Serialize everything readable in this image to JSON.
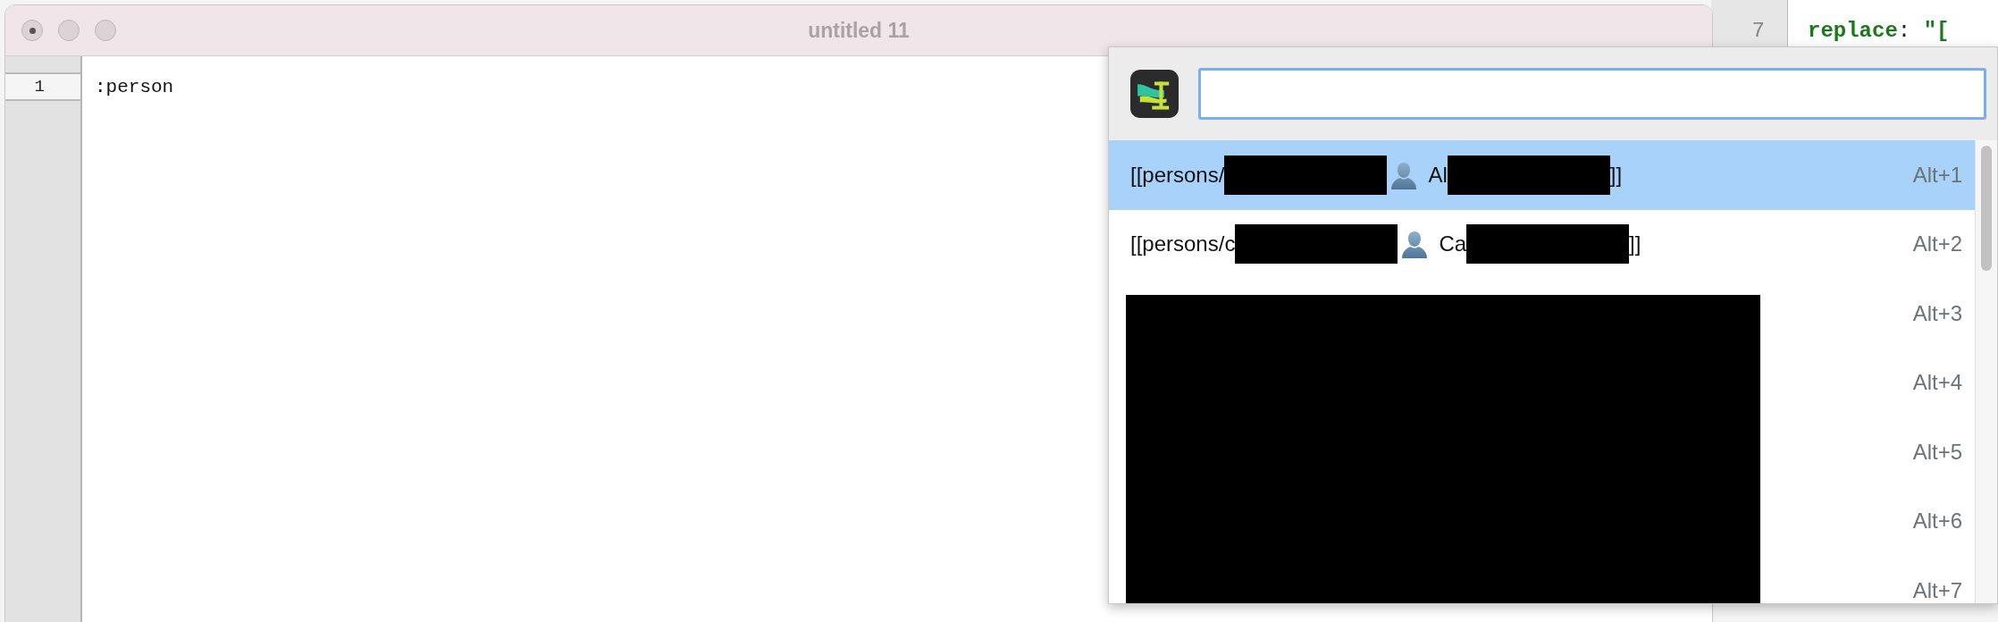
{
  "background_editor": {
    "lines": [
      {
        "number": "7",
        "key": "replace",
        "punct": ": ",
        "value": "\"["
      }
    ]
  },
  "window": {
    "title": "untitled 11",
    "lines": [
      {
        "number": "1",
        "text": ":person",
        "current": true
      }
    ]
  },
  "popup": {
    "results": [
      {
        "selected": true,
        "shortcut": "Alt+1",
        "redacted": false,
        "parts": [
          {
            "kind": "text",
            "text": "[[persons/"
          },
          {
            "kind": "redaction"
          },
          {
            "kind": "person"
          },
          {
            "kind": "text",
            "text": "Al"
          },
          {
            "kind": "redaction"
          },
          {
            "kind": "text",
            "text": "]]"
          }
        ]
      },
      {
        "selected": false,
        "shortcut": "Alt+2",
        "redacted": false,
        "parts": [
          {
            "kind": "text",
            "text": "[[persons/c"
          },
          {
            "kind": "redaction"
          },
          {
            "kind": "person"
          },
          {
            "kind": "text",
            "text": "Ca"
          },
          {
            "kind": "redaction"
          },
          {
            "kind": "text",
            "text": "]]"
          }
        ]
      },
      {
        "selected": false,
        "shortcut": "Alt+3",
        "redacted": true
      },
      {
        "selected": false,
        "shortcut": "Alt+4",
        "redacted": true
      },
      {
        "selected": false,
        "shortcut": "Alt+5",
        "redacted": true
      },
      {
        "selected": false,
        "shortcut": "Alt+6",
        "redacted": true
      },
      {
        "selected": false,
        "shortcut": "Alt+7",
        "redacted": true
      }
    ]
  }
}
